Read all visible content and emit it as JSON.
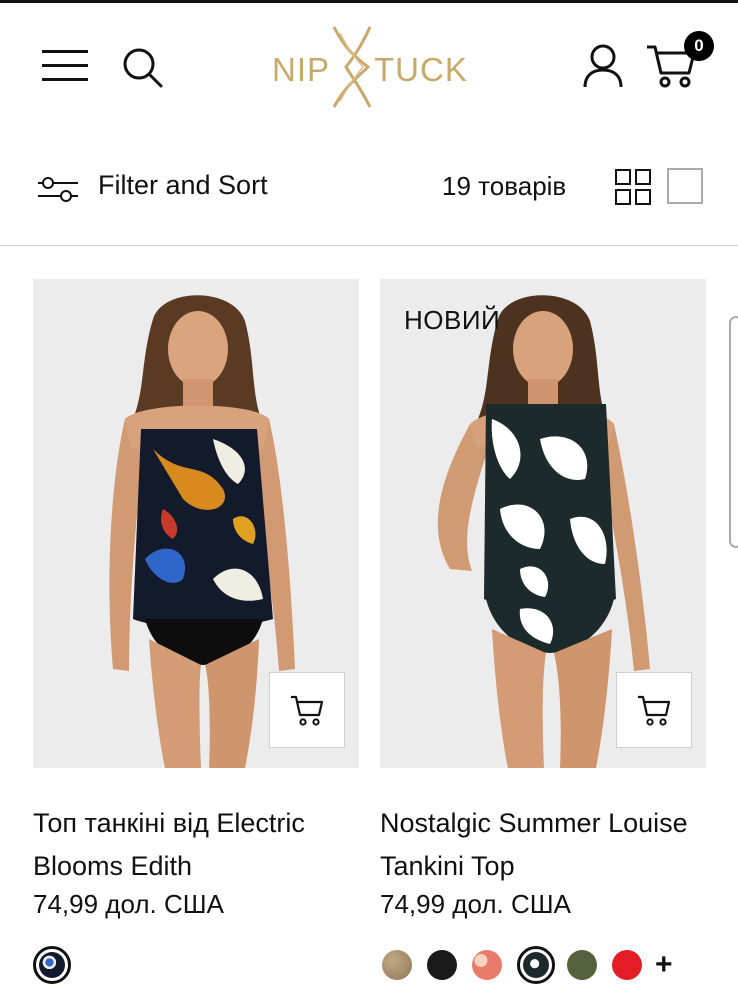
{
  "header": {
    "brand": "NIP TUCK",
    "brand_left": "NIP",
    "brand_right": "TUCK",
    "cart_count": "0",
    "icons": [
      "menu-icon",
      "search-icon",
      "account-icon",
      "cart-icon"
    ],
    "accent_color": "#c7a96b"
  },
  "toolbar": {
    "filter_label": "Filter and Sort",
    "count_label": "19 товарів",
    "icons": [
      "filter-sliders-icon",
      "grid-view-icon",
      "single-view-icon"
    ]
  },
  "products": [
    {
      "name": "Топ танкіні від Electric Blooms Edith",
      "price": "74,99 дол. США",
      "badge": "",
      "swatches": [
        {
          "color": "#111a2e",
          "selected": true
        }
      ],
      "more_colors": ""
    },
    {
      "name": "Nostalgic Summer Louise Tankini Top",
      "price": "74,99 дол. США",
      "badge": "НОВИЙ",
      "swatches": [
        {
          "color": "#a89070",
          "selected": false
        },
        {
          "color": "#1a1a1a",
          "selected": false
        },
        {
          "color": "#e97b6a",
          "selected": false
        },
        {
          "color": "#1d2a2b",
          "selected": true
        },
        {
          "color": "#55603c",
          "selected": false
        },
        {
          "color": "#e31c25",
          "selected": false
        }
      ],
      "more_colors": "+"
    }
  ]
}
